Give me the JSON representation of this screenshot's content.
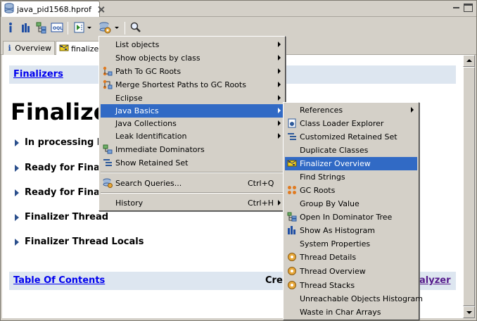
{
  "editor_tab": {
    "label": "java_pid1568.hprof"
  },
  "inner_tabs": [
    {
      "label": "Overview"
    },
    {
      "label": "finalizer"
    }
  ],
  "content": {
    "top_link": "Finalizers",
    "big_title": "Finalize",
    "sections": [
      "In processing l",
      "Ready for Fina",
      "Ready for Fina",
      "Finalizer Thread",
      "Finalizer Thread Locals"
    ],
    "bottom_link": "Table Of Contents",
    "created_text": "Cre",
    "analyzer_link": "alyzer"
  },
  "query_menu": {
    "items": [
      {
        "label": "List objects",
        "submenu": true
      },
      {
        "label": "Show objects by class",
        "submenu": true
      },
      {
        "label": "Path To GC Roots",
        "submenu": true,
        "icon": "path-gc-icon"
      },
      {
        "label": "Merge Shortest Paths to GC Roots",
        "submenu": true,
        "icon": "merge-paths-icon"
      },
      {
        "label": "Eclipse",
        "submenu": true
      },
      {
        "label": "Java Basics",
        "submenu": true,
        "highlighted": true
      },
      {
        "label": "Java Collections",
        "submenu": true
      },
      {
        "label": "Leak Identification",
        "submenu": true
      },
      {
        "label": "Immediate Dominators",
        "icon": "dominators-icon"
      },
      {
        "label": "Show Retained Set",
        "icon": "retained-set-icon"
      },
      {
        "label": "Search Queries...",
        "shortcut": "Ctrl+Q",
        "icon": "search-queries-icon"
      },
      {
        "label": "History",
        "shortcut": "Ctrl+H",
        "submenu": true
      }
    ]
  },
  "java_basics_menu": {
    "items": [
      {
        "label": "References",
        "submenu": true
      },
      {
        "label": "Class Loader Explorer",
        "icon": "class-loader-icon"
      },
      {
        "label": "Customized Retained Set",
        "icon": "customized-retained-icon"
      },
      {
        "label": "Duplicate Classes"
      },
      {
        "label": "Finalizer Overview",
        "icon": "finalizer-icon",
        "highlighted": true
      },
      {
        "label": "Find Strings"
      },
      {
        "label": "GC Roots",
        "icon": "gc-roots-icon"
      },
      {
        "label": "Group By Value"
      },
      {
        "label": "Open In Dominator Tree",
        "icon": "dominator-tree-icon"
      },
      {
        "label": "Show As Histogram",
        "icon": "histogram-icon"
      },
      {
        "label": "System Properties"
      },
      {
        "label": "Thread Details",
        "icon": "thread-gear-icon"
      },
      {
        "label": "Thread Overview",
        "icon": "thread-gear-icon"
      },
      {
        "label": "Thread Stacks",
        "icon": "thread-gear-icon"
      },
      {
        "label": "Unreachable Objects Histogram"
      },
      {
        "label": "Waste in Char Arrays"
      }
    ]
  },
  "colors": {
    "menu_highlight": "#316ac5",
    "link": "#0000ee",
    "bar_bg": "#dde6f0"
  }
}
